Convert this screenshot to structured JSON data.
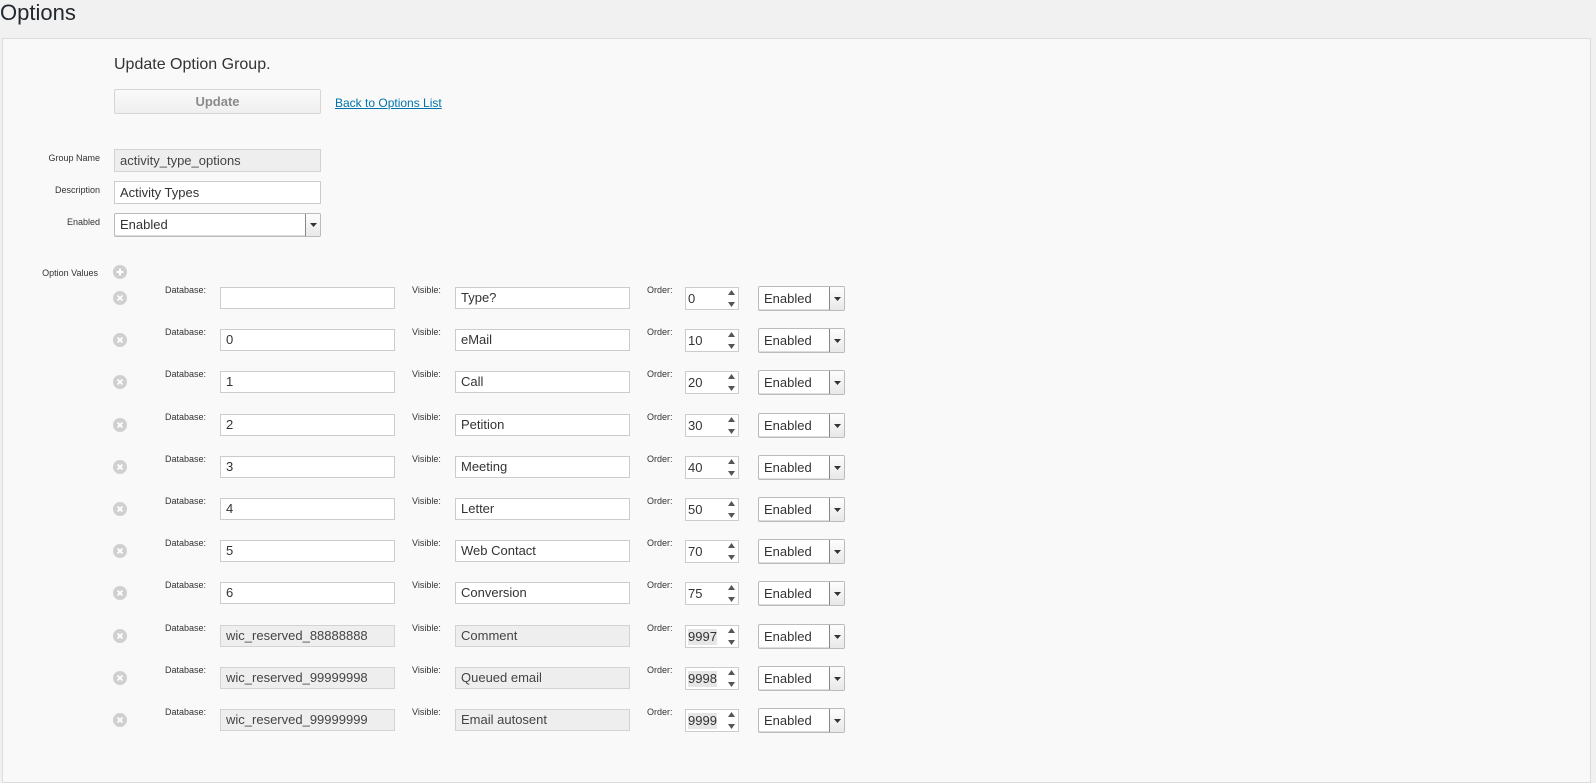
{
  "page": {
    "title": "Options"
  },
  "form": {
    "heading": "Update Option Group.",
    "update_label": "Update",
    "back_link": "Back to Options List",
    "group_name": {
      "label": "Group Name",
      "value": "activity_type_options"
    },
    "description": {
      "label": "Description",
      "value": "Activity Types"
    },
    "enabled": {
      "label": "Enabled",
      "value": "Enabled"
    }
  },
  "option_values": {
    "label": "Option Values",
    "labels": {
      "database": "Database:",
      "visible": "Visible:",
      "order": "Order:"
    },
    "rows": [
      {
        "database": "",
        "visible": "Type?",
        "order": "0",
        "status": "Enabled",
        "readonly": false
      },
      {
        "database": "0",
        "visible": "eMail",
        "order": "10",
        "status": "Enabled",
        "readonly": false
      },
      {
        "database": "1",
        "visible": "Call",
        "order": "20",
        "status": "Enabled",
        "readonly": false
      },
      {
        "database": "2",
        "visible": "Petition",
        "order": "30",
        "status": "Enabled",
        "readonly": false
      },
      {
        "database": "3",
        "visible": "Meeting",
        "order": "40",
        "status": "Enabled",
        "readonly": false
      },
      {
        "database": "4",
        "visible": "Letter",
        "order": "50",
        "status": "Enabled",
        "readonly": false
      },
      {
        "database": "5",
        "visible": "Web Contact",
        "order": "70",
        "status": "Enabled",
        "readonly": false
      },
      {
        "database": "6",
        "visible": "Conversion",
        "order": "75",
        "status": "Enabled",
        "readonly": false
      },
      {
        "database": "wic_reserved_88888888",
        "visible": "Comment",
        "order": "9997",
        "status": "Enabled",
        "readonly": true
      },
      {
        "database": "wic_reserved_99999998",
        "visible": "Queued email",
        "order": "9998",
        "status": "Enabled",
        "readonly": true
      },
      {
        "database": "wic_reserved_99999999",
        "visible": "Email autosent",
        "order": "9999",
        "status": "Enabled",
        "readonly": true
      }
    ]
  }
}
